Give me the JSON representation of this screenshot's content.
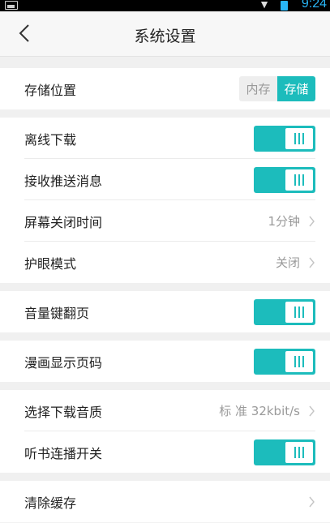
{
  "status_bar": {
    "time": "9:24"
  },
  "header": {
    "title": "系统设置"
  },
  "storage": {
    "label": "存储位置",
    "options": [
      "内存",
      "存储"
    ]
  },
  "settings": {
    "offline_download": "离线下载",
    "receive_push": "接收推送消息",
    "screen_off": {
      "label": "屏幕关闭时间",
      "value": "1分钟"
    },
    "eye_protection": {
      "label": "护眼模式",
      "value": "关闭"
    },
    "volume_key_page": "音量键翻页",
    "comic_page_number": "漫画显示页码",
    "download_quality": {
      "label": "选择下载音质",
      "value": "标 准 32kbit/s"
    },
    "audiobook_continuous": "听书连播开关",
    "clear_cache": "清除缓存"
  },
  "colors": {
    "accent": "#1cbcbc",
    "status_time": "#29b6f6"
  }
}
